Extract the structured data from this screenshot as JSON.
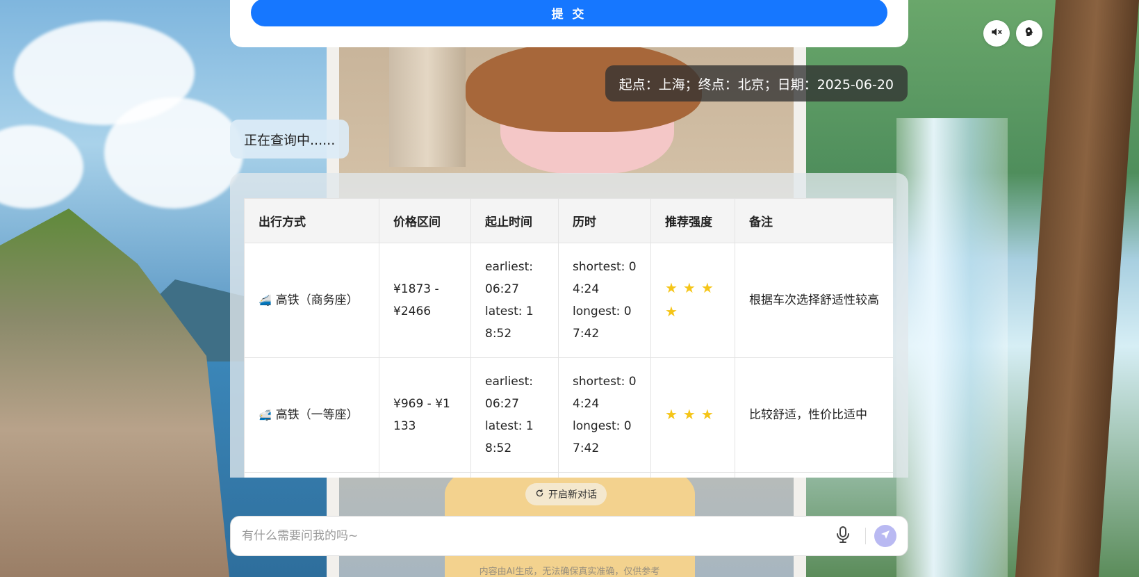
{
  "form": {
    "submit_label": "提 交"
  },
  "controls": {
    "mute_icon": "speaker-mute-icon",
    "brain_icon": "brain-head-icon"
  },
  "chat": {
    "user_message": "起点：上海；终点：北京；日期：2025-06-20",
    "bot_message": "正在查询中......"
  },
  "table": {
    "headers": [
      "出行方式",
      "价格区间",
      "起止时间",
      "历时",
      "推荐强度",
      "备注"
    ],
    "rows": [
      {
        "icon": "🚄",
        "mode": "高铁（商务座）",
        "price": "¥1873 - ¥2466",
        "time_earliest": "earliest: 06:27",
        "time_latest": "latest: 18:52",
        "dur_shortest": "shortest: 04:24",
        "dur_longest": "longest: 07:42",
        "stars": "★★★★",
        "rating": 4,
        "note": "根据车次选择舒适性较高"
      },
      {
        "icon": "🚅",
        "mode": "高铁（一等座）",
        "price": "¥969 - ¥1133",
        "time_earliest": "earliest: 06:27",
        "time_latest": "latest: 18:52",
        "dur_shortest": "shortest: 04:24",
        "dur_longest": "longest: 07:42",
        "stars": "★★★",
        "rating": 3,
        "note": "比较舒适，性价比适中"
      }
    ]
  },
  "new_chat_label": "开启新对话",
  "input": {
    "placeholder": "有什么需要问我的吗~"
  },
  "disclaimer": "内容由AI生成，无法确保真实准确，仅供参考"
}
